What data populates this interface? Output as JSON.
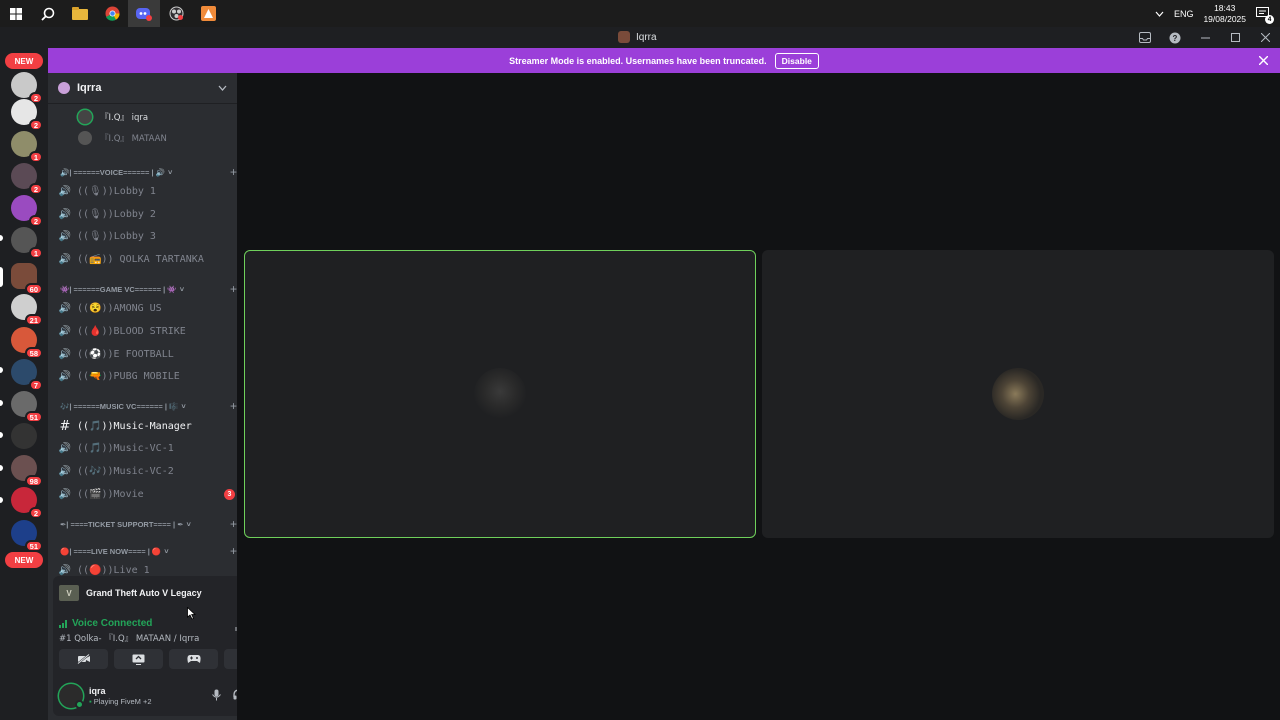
{
  "taskbar": {
    "apps": [
      {
        "icon": "windows-start-icon",
        "active": false
      },
      {
        "icon": "search-icon",
        "active": false
      },
      {
        "icon": "file-explorer-icon",
        "active": false
      },
      {
        "icon": "chrome-icon",
        "active": false
      },
      {
        "icon": "discord-icon",
        "active": true
      },
      {
        "icon": "obs-icon",
        "active": false
      },
      {
        "icon": "app-icon",
        "active": false
      }
    ],
    "language": "ENG",
    "time": "18:43",
    "date": "19/08/2025",
    "notification_count": "4"
  },
  "rail": {
    "new_top": "NEW",
    "new_bottom": "NEW",
    "badges": [
      "2",
      "2",
      "1",
      "2",
      "2",
      "1",
      "60",
      "21",
      "58",
      "7",
      "51",
      "98",
      "2",
      "51"
    ]
  },
  "window": {
    "title": "Iqrra",
    "controls": [
      "inbox-icon",
      "help-icon",
      "minimize-icon",
      "maximize-icon",
      "close-icon"
    ]
  },
  "banner": {
    "text": "Streamer Mode is enabled. Usernames have been truncated.",
    "button": "Disable"
  },
  "sidebar": {
    "server_name": "Iqrra",
    "members": [
      {
        "name": "『I.Q』 iqra",
        "speaking": true
      },
      {
        "name": "『I.Q』 MATAAN",
        "speaking": false
      }
    ],
    "categories": {
      "voice": "🔊| ======VOICE====== | 🔊",
      "game": "👾| ======GAME VC====== | 👾",
      "music": "🎶| ======MUSIC VC====== | 🎼",
      "ticket": "✒| ====TICKET SUPPORT==== | ✒",
      "live": "🔴| ====LIVE NOW==== | 🔴"
    },
    "channels": {
      "lobby1": "((🎙))Lobby 1",
      "lobby2": "((🎙))Lobby 2",
      "lobby3": "((🎙))Lobby 3",
      "qolka": "((📻)) QOLKA TARTANKA",
      "among": "((😵))AMONG US",
      "blood": "((🩸))BLOOD STRIKE",
      "football": "((⚽))E FOOTBALL",
      "pubg": "((🔫))PUBG MOBILE",
      "music_manager": "((🎵))Music-Manager",
      "music_vc1": "((🎵))Music-VC-1",
      "music_vc2": "((🎶))Music-VC-2",
      "movie": "((🎬))Movie",
      "movie_badge": "3",
      "live1": "((🔴))Live 1"
    }
  },
  "panel": {
    "game": "Grand Theft Auto V Legacy",
    "voice_status": "Voice Connected",
    "voice_detail": "#1 Qolka- 『I.Q』 MATAAN / Iqrra",
    "user": {
      "name": "iqra",
      "activity": "Playing FiveM +2"
    }
  },
  "colors": {
    "accent_banner": "#9b3fd9",
    "speaking_green": "#23a559",
    "badge_red": "#f23f43"
  }
}
